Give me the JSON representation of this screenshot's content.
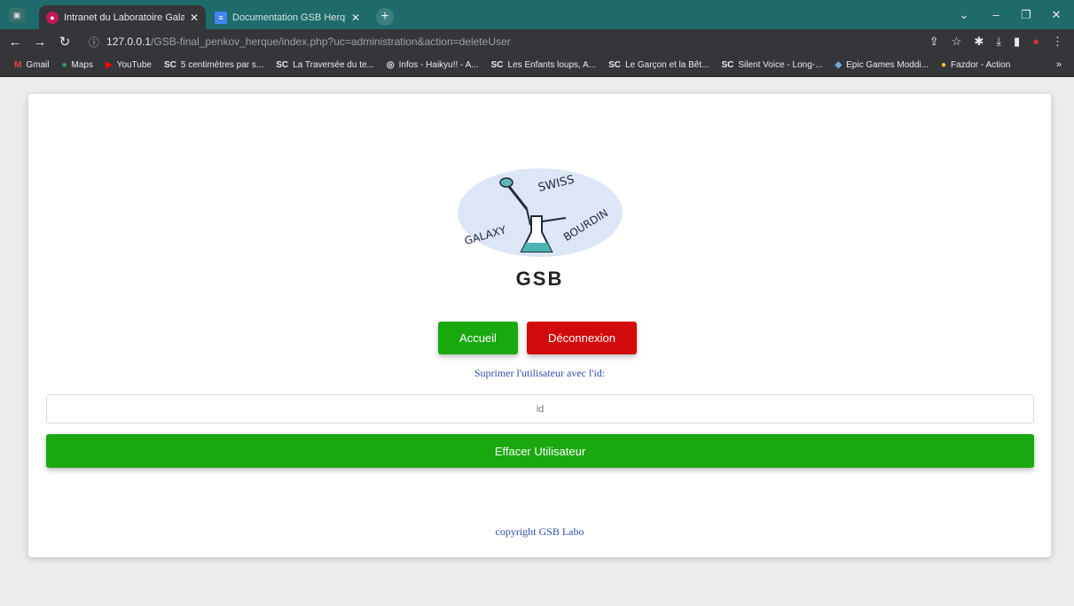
{
  "browser": {
    "tabs": [
      {
        "title": "Intranet du Laboratoire Galaxy-Sw",
        "active": true
      },
      {
        "title": "Documentation GSB Herque, Penkov",
        "active": false
      }
    ],
    "url_host": "127.0.0.1",
    "url_path": "/GSB-final_penkov_herque/index.php?uc=administration&action=deleteUser",
    "bookmarks": [
      {
        "label": "Gmail",
        "icon": "gmail-icon"
      },
      {
        "label": "Maps",
        "icon": "maps-icon"
      },
      {
        "label": "YouTube",
        "icon": "youtube-icon"
      },
      {
        "label": "5 centimètres par s...",
        "icon": "sc-icon"
      },
      {
        "label": "La Traversée du te...",
        "icon": "sc-icon"
      },
      {
        "label": "Infos - Haikyu!! - A...",
        "icon": "globe-icon"
      },
      {
        "label": "Les Enfants loups, A...",
        "icon": "sc-icon"
      },
      {
        "label": "Le Garçon et la Bêt...",
        "icon": "sc-icon"
      },
      {
        "label": "Silent Voice - Long-...",
        "icon": "sc-icon"
      },
      {
        "label": "Epic Games Moddi...",
        "icon": "epic-icon"
      },
      {
        "label": "Fazdor - Action",
        "icon": "bulb-icon"
      }
    ],
    "bookmarks_more": "»"
  },
  "page": {
    "logo": {
      "word1": "GALAXY",
      "word2": "SWISS",
      "word3": "BOURDIN"
    },
    "brand": "GSB",
    "home_label": "Accueil",
    "logout_label": "Déconnexion",
    "prompt": "Suprimer l'utilisateur avec l'id:",
    "id_placeholder": "id",
    "delete_label": "Effacer Utilisateur",
    "footer": "copyright GSB Labo"
  },
  "colors": {
    "green": "#1aa80f",
    "red": "#d10b0b",
    "link": "#2e4fb0",
    "chrome": "#35363a",
    "tabbar": "#1f6b6b"
  }
}
